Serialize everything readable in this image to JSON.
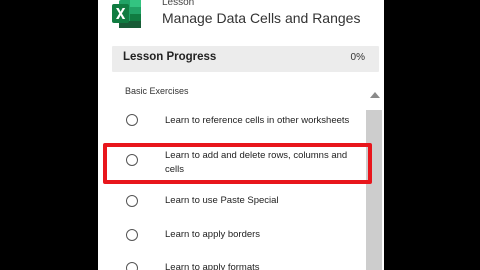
{
  "header": {
    "app_icon": "excel-logo-icon",
    "kicker": "Lesson",
    "title": "Manage Data Cells and Ranges"
  },
  "progress": {
    "label": "Lesson Progress",
    "value": "0%"
  },
  "section": {
    "heading": "Basic Exercises"
  },
  "items": [
    {
      "label": "Learn to reference cells in other worksheets",
      "checked": false
    },
    {
      "label": "Learn to add and delete rows, columns and cells",
      "checked": false
    },
    {
      "label": "Learn to use Paste Special",
      "checked": false
    },
    {
      "label": "Learn to apply borders",
      "checked": false
    },
    {
      "label": "Learn to apply formats",
      "checked": false
    }
  ],
  "colors": {
    "excel_green": "#107c41",
    "highlight": "#e8161c",
    "background": "#000000"
  }
}
